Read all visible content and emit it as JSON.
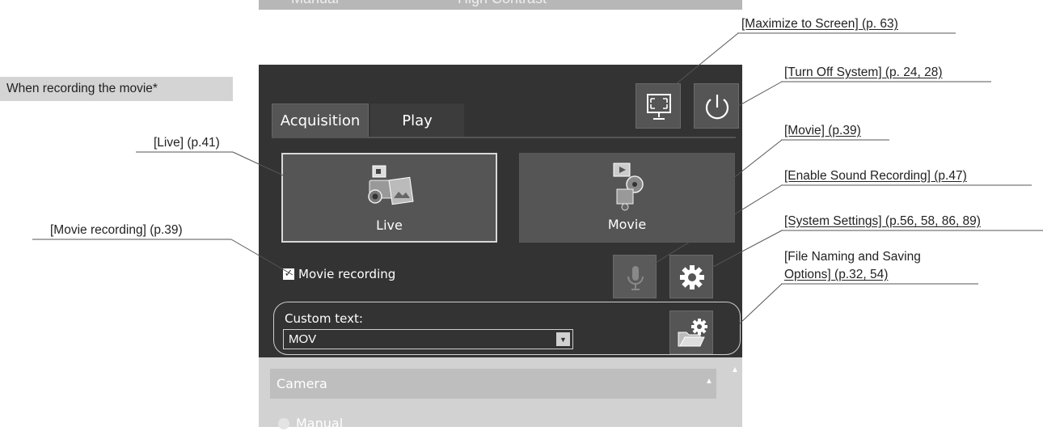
{
  "badge": "When recording the movie*",
  "top_strip": {
    "text_left": "Manual",
    "text_right": "High Contrast"
  },
  "tabs": [
    {
      "label": "Acquisition"
    },
    {
      "label": "Play"
    }
  ],
  "buttons": {
    "live": "Live",
    "movie": "Movie"
  },
  "checkbox": {
    "label": "Movie recording",
    "checked": true,
    "mark": "✓"
  },
  "custom_text": {
    "label": "Custom text:",
    "value": "MOV",
    "arrow": "▼"
  },
  "camera_panel": {
    "header": "Camera",
    "collapse": "▲",
    "scroll": "▲",
    "radio": "Manual"
  },
  "annotations": {
    "maximize": "[Maximize to Screen] (p. 63)",
    "turn_off": "[Turn Off System] (p. 24, 28)",
    "movie": "[Movie] (p.39)",
    "sound": "[Enable Sound Recording] (p.47)",
    "system_settings": "[System Settings] (p.56, 58, 86, 89)",
    "file_naming_1": "[File Naming and Saving",
    "file_naming_2": "Options] (p.32, 54)",
    "live": "[Live] (p.41)",
    "movie_recording": "[Movie recording] (p.39)"
  },
  "colors": {
    "panel": "#333333",
    "button": "#555555",
    "lower_panel": "#d2d2d2",
    "badge": "#d4d4d4"
  }
}
